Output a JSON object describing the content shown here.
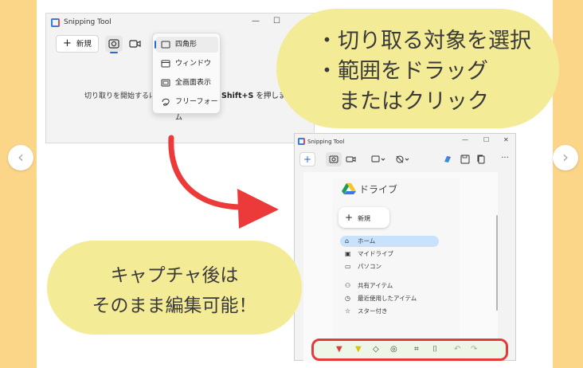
{
  "nav": {
    "prev_glyph": "‹",
    "next_glyph": "›"
  },
  "window1": {
    "title": "Snipping Tool",
    "controls": {
      "minimize": "—",
      "maximize": "☐"
    },
    "new_button": "新規",
    "hint_prefix": "切り取りを開始するに",
    "hint_suffix_bold": "Shift+S",
    "hint_suffix": " を押します",
    "dropdown": [
      {
        "label": "四角形",
        "icon": "rectangle-icon"
      },
      {
        "label": "ウィンドウ",
        "icon": "window-icon"
      },
      {
        "label": "全画面表示",
        "icon": "fullscreen-icon"
      },
      {
        "label": "フリーフォーム",
        "icon": "freeform-icon"
      }
    ]
  },
  "bubble_top": {
    "line1": "・切り取る対象を選択",
    "line2": "・範囲をドラッグ",
    "line3": "またはクリック"
  },
  "bubble_bottom": {
    "line1": "キャプチャ後は",
    "line2": "そのまま編集可能！"
  },
  "window2": {
    "title": "Snipping Tool",
    "controls": {
      "minimize": "—",
      "maximize": "☐",
      "close": "✕"
    },
    "new_plus": "+",
    "more": "···",
    "capture": {
      "app_title": "ドライブ",
      "new_button": "新規",
      "nav_items": [
        {
          "label": "ホーム",
          "icon": "home-icon",
          "glyph": "⌂",
          "active": true
        },
        {
          "label": "マイドライブ",
          "icon": "my-drive-icon",
          "glyph": "▣"
        },
        {
          "label": "パソコン",
          "icon": "computer-icon",
          "glyph": "▭"
        },
        {
          "label": "共有アイテム",
          "icon": "shared-icon",
          "glyph": "⚇"
        },
        {
          "label": "最近使用したアイテム",
          "icon": "clock-icon",
          "glyph": "◷"
        },
        {
          "label": "スター付き",
          "icon": "star-icon",
          "glyph": "☆"
        }
      ]
    },
    "edit_toolbar": [
      {
        "name": "ballpoint-pen-icon",
        "glyph": "▼",
        "color": "#e03a3a"
      },
      {
        "name": "highlighter-icon",
        "glyph": "▼",
        "color": "#d9c400"
      },
      {
        "name": "eraser-icon",
        "glyph": "◇",
        "color": "#444444"
      },
      {
        "name": "shapes-icon",
        "glyph": "◎",
        "color": "#444444"
      },
      {
        "name": "crop-icon",
        "glyph": "⌗",
        "color": "#444444"
      },
      {
        "name": "text-recognition-icon",
        "glyph": "⌷",
        "color": "#444444"
      },
      {
        "name": "undo-icon",
        "glyph": "↶",
        "color": "#aaaaaa"
      },
      {
        "name": "redo-icon",
        "glyph": "↷",
        "color": "#aaaaaa"
      }
    ]
  },
  "colors": {
    "background": "#fbd689",
    "bubble": "#f4eb96",
    "arrow": "#ec3a3a",
    "highlight_border": "#e63a3a",
    "accent": "#2a6bd3"
  }
}
